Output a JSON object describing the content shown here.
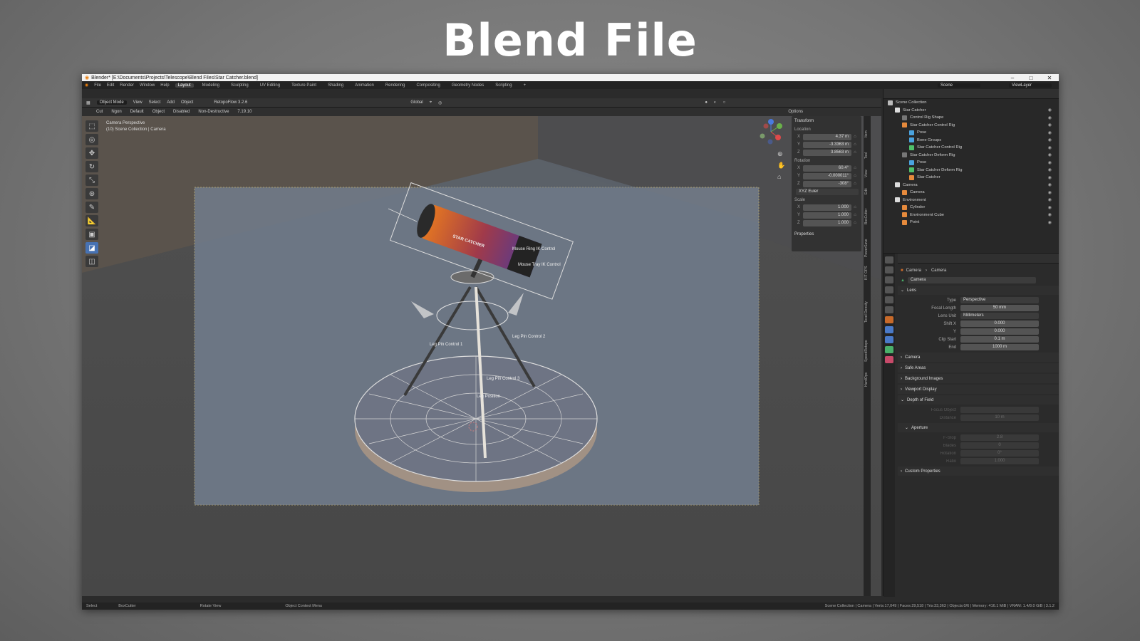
{
  "slide_title": "Blend File",
  "window": {
    "title": "Blender* [E:\\Documents\\Projects\\Telescope\\Blend Files\\Star Catcher.blend]"
  },
  "menu": [
    "File",
    "Edit",
    "Render",
    "Window",
    "Help"
  ],
  "workspaces": [
    "Layout",
    "Modeling",
    "Sculpting",
    "UV Editing",
    "Texture Paint",
    "Shading",
    "Animation",
    "Rendering",
    "Compositing",
    "Geometry Nodes",
    "Scripting",
    "+"
  ],
  "scene_field": "Scene",
  "viewlayer_field": "ViewLayer",
  "header": {
    "mode": "Object Mode",
    "items": [
      "View",
      "Select",
      "Add",
      "Object"
    ],
    "addon": "RetopoFlow 3.2.6",
    "transform": "Global"
  },
  "tool_header": {
    "cut": "Cut",
    "ngon": "Ngon",
    "default": "Default",
    "object": "Object",
    "disabled": "Disabled",
    "non_destructive": "Non-Destructive",
    "version": "7.19.10",
    "options": "Options"
  },
  "viewport": {
    "perspective": "Camera Perspective",
    "collection": "(10) Scene Collection | Camera"
  },
  "transform": {
    "title": "Transform",
    "location_label": "Location",
    "rotation_label": "Rotation",
    "scale_label": "Scale",
    "euler": "XYZ Euler",
    "properties": "Properties",
    "location": [
      {
        "axis": "X",
        "value": "4.37 m"
      },
      {
        "axis": "Y",
        "value": "-3.3363 m"
      },
      {
        "axis": "Z",
        "value": "3.8563 m"
      }
    ],
    "rotation": [
      {
        "axis": "X",
        "value": "60.4°"
      },
      {
        "axis": "Y",
        "value": "-0.000011°"
      },
      {
        "axis": "Z",
        "value": "-308°"
      }
    ],
    "scale": [
      {
        "axis": "X",
        "value": "1.000"
      },
      {
        "axis": "Y",
        "value": "1.000"
      },
      {
        "axis": "Z",
        "value": "1.000"
      }
    ]
  },
  "side_tabs": [
    "Item",
    "Tool",
    "View",
    "Edit",
    "BoxCutter",
    "PowerSave",
    "KIT OPS",
    "Texel Density",
    "SpeedRetopo",
    "HardOps"
  ],
  "annotations": [
    {
      "id": "label-star",
      "text": "STAR CATCHER"
    },
    {
      "id": "label-mouse-1",
      "text": "Mouse Ring IK Control"
    },
    {
      "id": "label-mouse-2",
      "text": "Mouse Tray IK Control"
    },
    {
      "id": "label-leg-1",
      "text": "Leg Pin Control 1"
    },
    {
      "id": "label-leg-2",
      "text": "Leg Pin Control 2"
    },
    {
      "id": "label-leg-3",
      "text": "Leg Pin Control 3"
    },
    {
      "id": "label-leg-pos",
      "text": "Leg Position"
    }
  ],
  "outliner": {
    "items": [
      {
        "label": "Scene Collection",
        "indent": 0,
        "color": "#bbbbbb"
      },
      {
        "label": "Star Catcher",
        "indent": 1,
        "color": "#dddddd"
      },
      {
        "label": "Control Rig Shape",
        "indent": 2,
        "color": "#777777"
      },
      {
        "label": "Star Catcher Control Rig",
        "indent": 2,
        "color": "#e68a3c"
      },
      {
        "label": "Pose",
        "indent": 3,
        "color": "#4aa3df"
      },
      {
        "label": "Bone Groups",
        "indent": 3,
        "color": "#4aa3df"
      },
      {
        "label": "Star Catcher Control Rig",
        "indent": 3,
        "color": "#4fc06a"
      },
      {
        "label": "Star Catcher Deform Rig",
        "indent": 2,
        "color": "#777777"
      },
      {
        "label": "Pose",
        "indent": 3,
        "color": "#4aa3df"
      },
      {
        "label": "Star Catcher Deform Rig",
        "indent": 3,
        "color": "#4fc06a"
      },
      {
        "label": "Star Catcher",
        "indent": 3,
        "color": "#e68a3c"
      },
      {
        "label": "Camera",
        "indent": 1,
        "color": "#dddddd"
      },
      {
        "label": "Camera",
        "indent": 2,
        "color": "#e68a3c"
      },
      {
        "label": "Environment",
        "indent": 1,
        "color": "#dddddd"
      },
      {
        "label": "Cylinder",
        "indent": 2,
        "color": "#e68a3c"
      },
      {
        "label": "Environment Cube",
        "indent": 2,
        "color": "#e68a3c"
      },
      {
        "label": "Point",
        "indent": 2,
        "color": "#e68a3c"
      }
    ]
  },
  "properties": {
    "breadcrumb_a": "Camera",
    "breadcrumb_b": "Camera",
    "datablock": "Camera",
    "lens_section": "Lens",
    "rows": [
      {
        "label": "Type",
        "value": "Perspective"
      },
      {
        "label": "Focal Length",
        "value": "50 mm"
      },
      {
        "label": "Lens Unit",
        "value": "Millimeters"
      },
      {
        "label": "Shift X",
        "value": "0.000"
      },
      {
        "label": "Y",
        "value": "0.000"
      },
      {
        "label": "Clip Start",
        "value": "0.1 m"
      },
      {
        "label": "End",
        "value": "1000 m"
      }
    ],
    "sections": [
      "Camera",
      "Safe Areas",
      "Background Images",
      "Viewport Display",
      "Depth of Field"
    ],
    "dof_rows": [
      {
        "label": "Focus Object",
        "value": ""
      },
      {
        "label": "Distance",
        "value": "10 m"
      }
    ],
    "aperture": "Aperture",
    "aperture_rows": [
      {
        "label": "F-Stop",
        "value": "2.8"
      },
      {
        "label": "Blades",
        "value": "0"
      },
      {
        "label": "Rotation",
        "value": "0°"
      },
      {
        "label": "Ratio",
        "value": "1.000"
      }
    ],
    "custom": "Custom Properties"
  },
  "statusbar": {
    "select": "Select",
    "boxcutter": "BoxCutter",
    "rotate": "Rotate View",
    "context": "Object Context Menu",
    "stats": "Scene Collection | Camera | Verts:17,049 | Faces:29,518 | Tris:33,363 | Objects:0/6 | Memory: 416.1 MiB | VRAM: 1.4/8.0 GiB | 3.1.2"
  }
}
